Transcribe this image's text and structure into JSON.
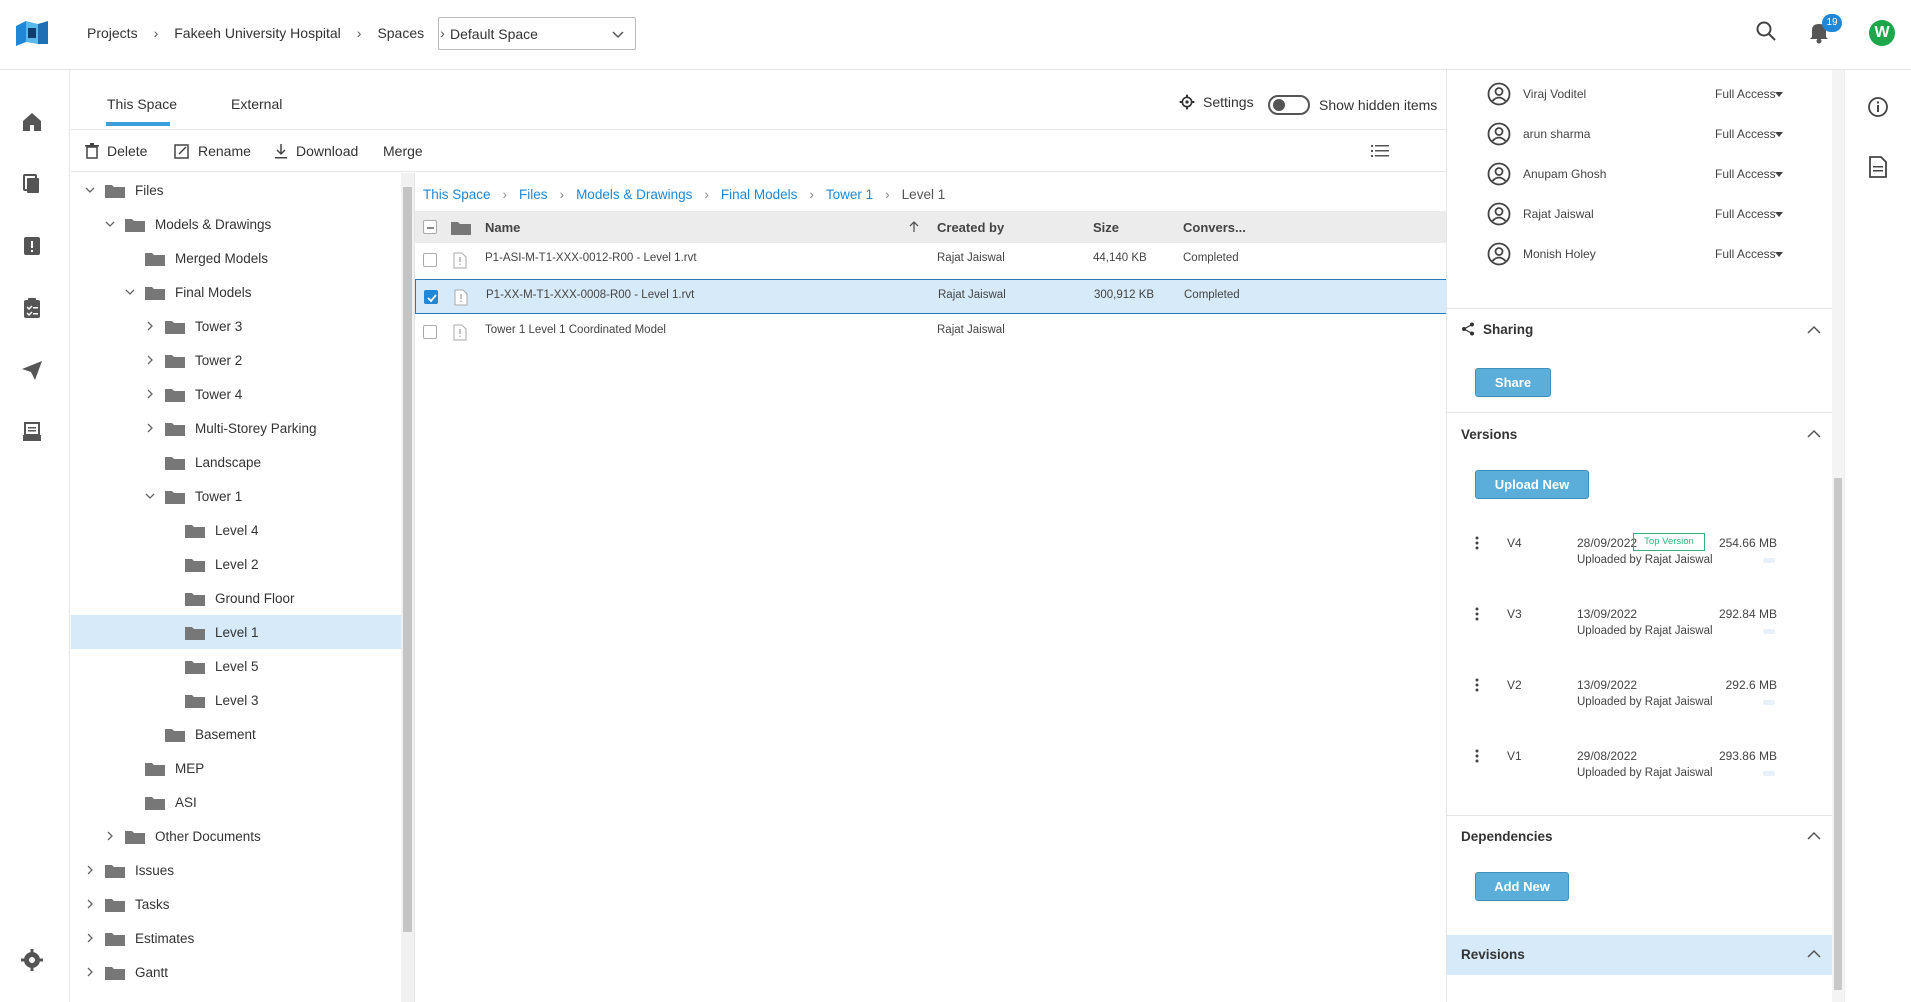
{
  "breadcrumb": [
    "Projects",
    "Fakeeh University Hospital",
    "Spaces"
  ],
  "space_select": "Default Space",
  "notifications_count": "19",
  "user_initial": "W",
  "tabs": [
    "This Space",
    "External"
  ],
  "settings_label": "Settings",
  "show_hidden_label": "Show hidden items",
  "toolbar": {
    "delete": "Delete",
    "rename": "Rename",
    "download": "Download",
    "merge": "Merge"
  },
  "tree": [
    {
      "label": "Files",
      "expanded": true
    },
    {
      "label": "Models & Drawings",
      "expanded": true
    },
    {
      "label": "Merged Models"
    },
    {
      "label": "Final Models",
      "expanded": true
    },
    {
      "label": "Tower 3",
      "expanded": false
    },
    {
      "label": "Tower 2",
      "expanded": false
    },
    {
      "label": "Tower 4",
      "expanded": false
    },
    {
      "label": "Multi-Storey Parking",
      "expanded": false
    },
    {
      "label": "Landscape"
    },
    {
      "label": "Tower 1",
      "expanded": true
    },
    {
      "label": "Level 4"
    },
    {
      "label": "Level 2"
    },
    {
      "label": "Ground Floor"
    },
    {
      "label": "Level 1",
      "selected": true
    },
    {
      "label": "Level 5"
    },
    {
      "label": "Level 3"
    },
    {
      "label": "Basement"
    },
    {
      "label": "MEP"
    },
    {
      "label": "ASI"
    },
    {
      "label": "Other Documents",
      "expanded": false
    },
    {
      "label": "Issues",
      "expanded": false
    },
    {
      "label": "Tasks",
      "expanded": false
    },
    {
      "label": "Estimates",
      "expanded": false
    },
    {
      "label": "Gantt",
      "expanded": false
    }
  ],
  "path": [
    "This Space",
    "Files",
    "Models & Drawings",
    "Final Models",
    "Tower 1",
    "Level 1"
  ],
  "columns": {
    "name": "Name",
    "created_by": "Created by",
    "size": "Size",
    "conversion": "Convers..."
  },
  "files": [
    {
      "name": "P1-ASI-M-T1-XXX-0012-R00 - Level 1.rvt",
      "created_by": "Rajat Jaiswal",
      "size": "44,140 KB",
      "status": "Completed",
      "checked": false
    },
    {
      "name": "P1-XX-M-T1-XXX-0008-R00 - Level 1.rvt",
      "created_by": "Rajat Jaiswal",
      "size": "300,912 KB",
      "status": "Completed",
      "checked": true
    },
    {
      "name": "Tower 1 Level 1 Coordinated Model",
      "created_by": "Rajat Jaiswal",
      "size": "",
      "status": "",
      "checked": false
    }
  ],
  "members": [
    {
      "name": "Viraj Voditel",
      "access": "Full Access"
    },
    {
      "name": "arun sharma",
      "access": "Full Access"
    },
    {
      "name": "Anupam Ghosh",
      "access": "Full Access"
    },
    {
      "name": "Rajat Jaiswal",
      "access": "Full Access"
    },
    {
      "name": "Monish Holey",
      "access": "Full Access"
    }
  ],
  "sharing": {
    "title": "Sharing",
    "button": "Share"
  },
  "versions": {
    "title": "Versions",
    "button": "Upload New",
    "top_label": "Top Version",
    "items": [
      {
        "v": "V4",
        "date": "28/09/2022",
        "by": "Uploaded by Rajat Jaiswal",
        "size": "254.66 MB"
      },
      {
        "v": "V3",
        "date": "13/09/2022",
        "by": "Uploaded by Rajat Jaiswal",
        "size": "292.84 MB"
      },
      {
        "v": "V2",
        "date": "13/09/2022",
        "by": "Uploaded by Rajat Jaiswal",
        "size": "292.6 MB"
      },
      {
        "v": "V1",
        "date": "29/08/2022",
        "by": "Uploaded by Rajat Jaiswal",
        "size": "293.86 MB"
      }
    ]
  },
  "dependencies": {
    "title": "Dependencies",
    "button": "Add New"
  },
  "revisions": {
    "title": "Revisions"
  }
}
